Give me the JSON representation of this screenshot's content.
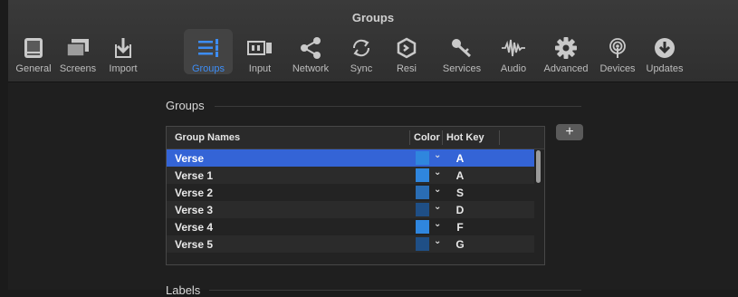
{
  "window": {
    "title": "Groups"
  },
  "toolbar": {
    "tabs": [
      {
        "label": "General",
        "icon": "general-icon"
      },
      {
        "label": "Screens",
        "icon": "screens-icon"
      },
      {
        "label": "Import",
        "icon": "import-icon"
      },
      {
        "label": "Groups",
        "icon": "groups-icon",
        "active": true
      },
      {
        "label": "Input",
        "icon": "input-icon"
      },
      {
        "label": "Network",
        "icon": "network-icon"
      },
      {
        "label": "Sync",
        "icon": "sync-icon"
      },
      {
        "label": "Resi",
        "icon": "resi-icon"
      },
      {
        "label": "Services",
        "icon": "services-icon"
      },
      {
        "label": "Audio",
        "icon": "audio-icon"
      },
      {
        "label": "Advanced",
        "icon": "advanced-icon"
      },
      {
        "label": "Devices",
        "icon": "devices-icon"
      },
      {
        "label": "Updates",
        "icon": "updates-icon"
      }
    ]
  },
  "groups_section": {
    "title": "Groups",
    "add_label": "+",
    "columns": {
      "name": "Group Names",
      "color": "Color",
      "hotkey": "Hot Key"
    },
    "rows": [
      {
        "name": "Verse",
        "color": "#2f86de",
        "hotkey": "A",
        "selected": true
      },
      {
        "name": "Verse 1",
        "color": "#2f86de",
        "hotkey": "A"
      },
      {
        "name": "Verse 2",
        "color": "#2a6db4",
        "hotkey": "S"
      },
      {
        "name": "Verse 3",
        "color": "#1f4f86",
        "hotkey": "D"
      },
      {
        "name": "Verse 4",
        "color": "#2f86de",
        "hotkey": "F"
      },
      {
        "name": "Verse 5",
        "color": "#1f4f86",
        "hotkey": "G"
      }
    ]
  },
  "labels_section": {
    "title": "Labels"
  },
  "colors": {
    "accent": "#3d8df5",
    "selection": "#3464d6"
  }
}
